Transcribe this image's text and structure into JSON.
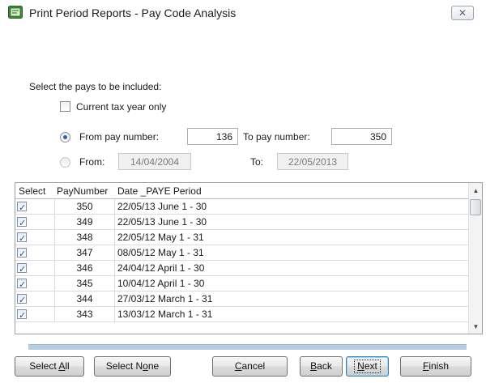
{
  "window": {
    "title": "Print Period Reports - Pay Code Analysis",
    "close_glyph": "✕"
  },
  "filters": {
    "select_label": "Select the pays to be included:",
    "current_tax_year_label": "Current tax year only",
    "current_tax_year_checked": false,
    "from_pay_label": "From pay number:",
    "from_pay_value": "136",
    "to_pay_label": "To pay number:",
    "to_pay_value": "350",
    "from_date_label": "From:",
    "from_date_value": "14/04/2004",
    "to_date_label": "To:",
    "to_date_value": "22/05/2013",
    "selected_mode": "pay-number"
  },
  "grid": {
    "columns": [
      "Select",
      "PayNumber",
      "Date _PAYE Period"
    ],
    "rows": [
      {
        "checked": true,
        "pay": "350",
        "period": "22/05/13 June 1 - 30"
      },
      {
        "checked": true,
        "pay": "349",
        "period": "22/05/13 June 1 - 30"
      },
      {
        "checked": true,
        "pay": "348",
        "period": "22/05/12 May 1 - 31"
      },
      {
        "checked": true,
        "pay": "347",
        "period": "08/05/12 May 1 - 31"
      },
      {
        "checked": true,
        "pay": "346",
        "period": "24/04/12 April 1 - 30"
      },
      {
        "checked": true,
        "pay": "345",
        "period": "10/04/12 April 1 - 30"
      },
      {
        "checked": true,
        "pay": "344",
        "period": "27/03/12 March 1 - 31"
      },
      {
        "checked": true,
        "pay": "343",
        "period": "13/03/12 March 1 - 31"
      }
    ]
  },
  "buttons": {
    "select_all": {
      "pre": "Select ",
      "key": "A",
      "post": "ll"
    },
    "select_none": {
      "pre": "Select N",
      "key": "o",
      "post": "ne"
    },
    "cancel": {
      "pre": "",
      "key": "C",
      "post": "ancel"
    },
    "back": {
      "pre": "",
      "key": "B",
      "post": "ack"
    },
    "next": {
      "pre": "",
      "key": "N",
      "post": "ext"
    },
    "finish": {
      "pre": "",
      "key": "F",
      "post": "inish"
    }
  },
  "colors": {
    "accent": "#2b62b6",
    "progress": "#b8cde0"
  },
  "icons": {
    "app": "report-window-icon",
    "scroll_up": "scroll-up-icon",
    "scroll_down": "scroll-down-icon",
    "check": "checkmark-icon"
  }
}
